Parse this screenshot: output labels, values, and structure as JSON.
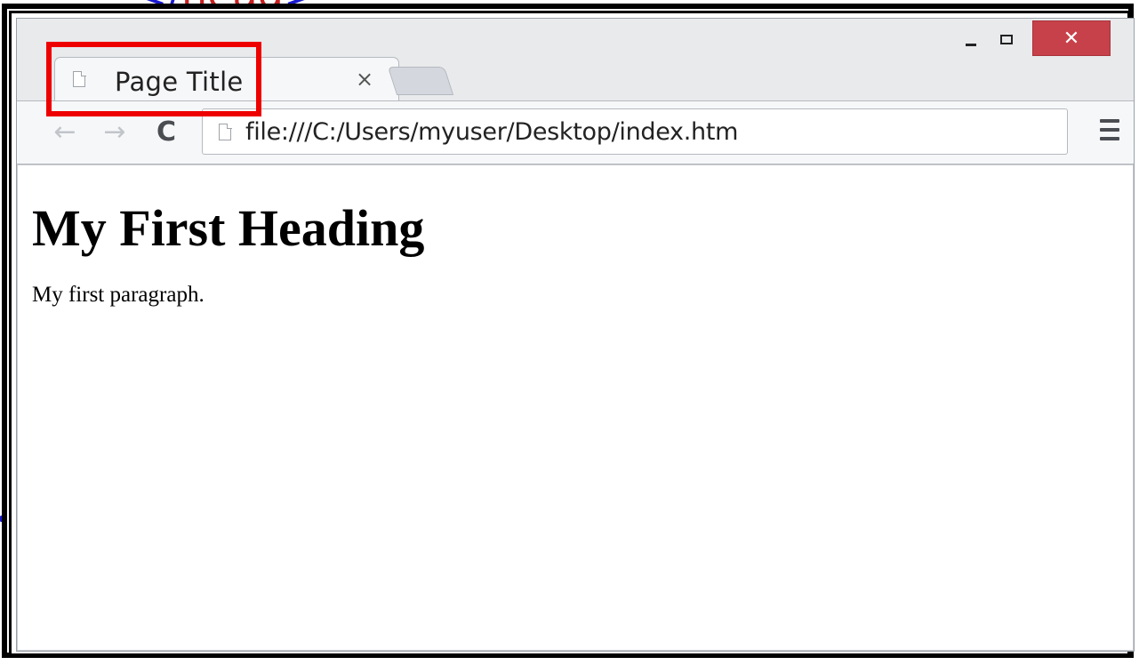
{
  "background": {
    "code_top_open": "</",
    "code_top_tag": "head",
    "code_top_close": ">",
    "code_left": "<"
  },
  "browser": {
    "tab": {
      "title": "Page Title",
      "close_glyph": "×",
      "icon": "page-icon"
    },
    "window_controls": {
      "close_glyph": "✕"
    },
    "toolbar": {
      "back_glyph": "←",
      "forward_glyph": "→",
      "reload_glyph": "C",
      "url": "file:///C:/Users/myuser/Desktop/index.htm"
    },
    "page": {
      "heading": "My First Heading",
      "paragraph": "My first paragraph."
    }
  },
  "colors": {
    "highlight": "#ee0000",
    "close_button": "#c7414a"
  }
}
